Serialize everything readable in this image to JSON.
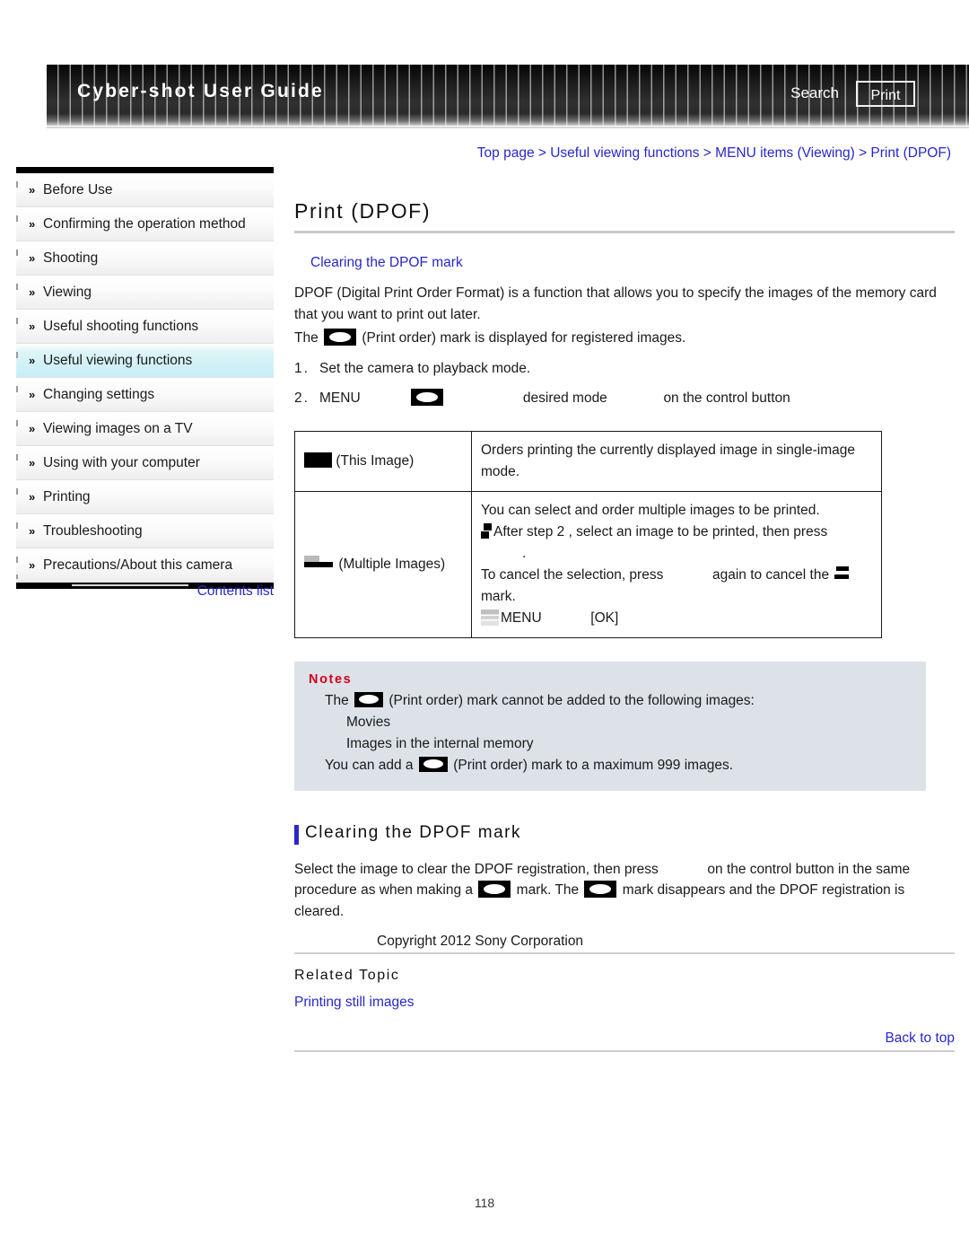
{
  "header": {
    "site_title": "Cyber-shot User Guide",
    "search_label": "Search",
    "print_label": "Print"
  },
  "breadcrumb": {
    "text": "Top page > Useful viewing functions > MENU items (Viewing) > Print (DPOF)"
  },
  "sidebar": {
    "bullet": "»",
    "items": [
      {
        "label": "Before Use"
      },
      {
        "label": "Confirming the operation method"
      },
      {
        "label": "Shooting"
      },
      {
        "label": "Viewing"
      },
      {
        "label": "Useful shooting functions"
      },
      {
        "label": "Useful viewing functions"
      },
      {
        "label": "Changing settings"
      },
      {
        "label": "Viewing images on a TV"
      },
      {
        "label": "Using with your computer"
      },
      {
        "label": "Printing"
      },
      {
        "label": "Troubleshooting"
      },
      {
        "label": "Precautions/About this camera"
      }
    ],
    "contents_list_label": "Contents list"
  },
  "main": {
    "page_title": "Print (DPOF)",
    "anchor_link": "Clearing the DPOF mark",
    "intro_p1": "DPOF (Digital Print Order Format) is a function that allows you to specify the images of the memory card that you want to print out later.",
    "intro_p2_pre": "The",
    "intro_p2_post": "(Print order) mark is displayed for registered images.",
    "steps": [
      {
        "num": "1.",
        "text": "Set the camera to playback mode."
      },
      {
        "num": "2.",
        "part1": "MENU",
        "part2": "desired mode",
        "part3": "on the control button"
      }
    ],
    "table": {
      "rows": [
        {
          "mode_label": "(This Image)",
          "mode_icon": "this-image-icon",
          "desc": "Orders printing the currently displayed image in single-image mode."
        },
        {
          "mode_label": "(Multiple Images)",
          "mode_icon": "multiple-images-icon",
          "desc_line1": "You can select and order multiple images to be printed.",
          "desc_line2": "After step 2 , select an image to be printed, then press",
          "desc_line2_end": ".",
          "desc_line3_a": "To cancel the selection, press",
          "desc_line3_b": "again to cancel the",
          "desc_line3_c": "mark.",
          "desc_line4_a": "MENU",
          "desc_line4_b": "[OK]"
        }
      ]
    },
    "notes": {
      "title": "Notes",
      "line1_pre": "The",
      "line1_post": "(Print order) mark cannot be added to the following images:",
      "bullet1": "Movies",
      "bullet2": "Images in the internal memory",
      "line2_pre": "You can add a",
      "line2_post": "(Print order) mark to a maximum 999 images."
    },
    "clearing": {
      "heading": "Clearing the DPOF mark",
      "p_a": "Select the image to clear the DPOF registration, then press",
      "p_b": "on the control button in the same procedure as when making a",
      "p_c": "mark. The",
      "p_d": "mark disappears and the DPOF registration is cleared."
    },
    "related": {
      "title": "Related Topic",
      "link": "Printing still images"
    },
    "back_to_top": "Back to top"
  },
  "footer": {
    "copyright": "Copyright 2012 Sony Corporation",
    "page_number": "118"
  },
  "colors": {
    "link": "#2828c8",
    "notes_bg": "#dde2e9",
    "notes_title": "#d0021b",
    "sidebar_active": "#c7eef5",
    "accent_bar": "#2828c8"
  }
}
